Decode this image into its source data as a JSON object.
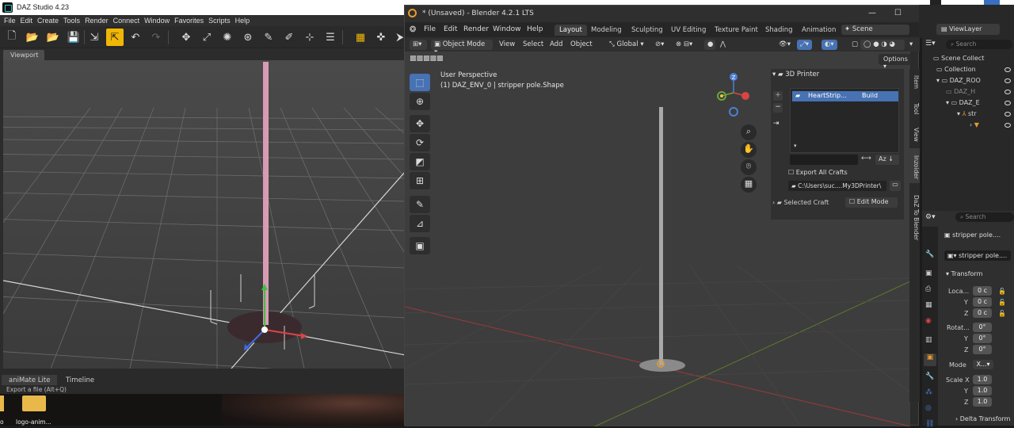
{
  "daz": {
    "title": "DAZ Studio 4.23",
    "menu": [
      "File",
      "Edit",
      "Create",
      "Tools",
      "Render",
      "Connect",
      "Window",
      "Favorites",
      "Scripts",
      "Help"
    ],
    "viewport_tab": "Viewport",
    "bottom_tabs": [
      "aniMate Lite",
      "Timeline"
    ],
    "status": "Export a file (Alt+Q)"
  },
  "desktop": {
    "icon_label_left": "o",
    "icon_label": "logo-anim..."
  },
  "blender": {
    "title": "* (Unsaved) - Blender 4.2.1 LTS",
    "menu": [
      "File",
      "Edit",
      "Render",
      "Window",
      "Help"
    ],
    "workspace_tabs": [
      "Layout",
      "Modeling",
      "Sculpting",
      "UV Editing",
      "Texture Paint",
      "Shading",
      "Animation"
    ],
    "active_tab": "Layout",
    "scene_label": "Scene",
    "viewlayer_label": "ViewLayer",
    "header": {
      "mode": "Object Mode",
      "view": "View",
      "select": "Select",
      "add": "Add",
      "object": "Object",
      "orientation": "Global"
    },
    "options_label": "Options",
    "viewport_info": {
      "line1": "User Perspective",
      "line2": "(1) DAZ_ENV_0 | stripper pole.Shape"
    },
    "gizmo": {
      "x": "X",
      "y": "Y",
      "z": "Z"
    },
    "npanel": {
      "section": "3D Printer",
      "list_item_name": "HeartStrip...",
      "list_item_action": "Build",
      "export_all": "Export All Crafts",
      "path": "C:\\Users\\suc....My3DPrinter\\",
      "selected_craft": "Selected Craft",
      "edit_mode": "Edit Mode",
      "sort_label": "Az"
    },
    "side_tabs": [
      "Item",
      "Tool",
      "View",
      "Inzoider",
      "DaZ To Blender"
    ],
    "active_side_tab": "Inzoider"
  },
  "outliner": {
    "search": "Search",
    "root": "Scene Collect",
    "rows": [
      "Collection",
      "DAZ_ROO",
      "DAZ_H",
      "DAZ_E",
      "str",
      ""
    ]
  },
  "properties": {
    "search": "Search",
    "object_name": "stripper pole....",
    "mesh_name": "stripper pole....",
    "transform_label": "Transform",
    "location_label": "Loca...",
    "rotation_label": "Rotat...",
    "mode_label": "Mode",
    "mode_value": "X...",
    "scale_label": "Scale X",
    "axes": [
      "Y",
      "Z"
    ],
    "loc_values": [
      "0 c",
      "0 c",
      "0 c"
    ],
    "rot_values": [
      "0°",
      "0°",
      "0°"
    ],
    "scale_values": [
      "1.0",
      "1.0",
      "1.0"
    ],
    "delta_label": "Delta Transform"
  },
  "colors": {
    "accent_blue": "#4772b3",
    "daz_highlight": "#f2b705",
    "pole_pink": "#d89bb4",
    "x_axis": "#d94545",
    "y_axis": "#6ea33a",
    "z_axis": "#4e7fd6"
  }
}
